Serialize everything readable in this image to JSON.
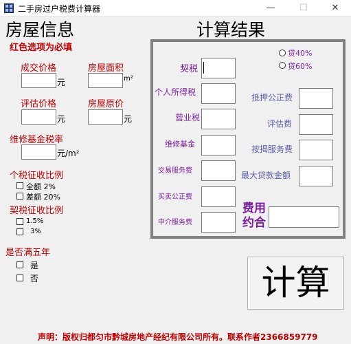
{
  "window": {
    "title": "二手房过户税费计算器",
    "minimize_glyph": "—",
    "maximize_glyph": "☐",
    "close_glyph": "✕"
  },
  "left": {
    "heading": "房屋信息",
    "required_note": "红色选项为必填",
    "deal_price_label": "成交价格",
    "deal_price_unit": "元",
    "area_label": "房屋面积",
    "area_unit": "m²",
    "eval_price_label": "评估价格",
    "eval_price_unit": "元",
    "orig_price_label": "房屋原价",
    "orig_price_unit": "元",
    "maint_rate_label": "维修基金税率",
    "maint_rate_unit": "元/m²",
    "income_tax_ratio_label": "个税征收比例",
    "income_full": "全额  2%",
    "income_diff": "差额 20%",
    "deed_tax_ratio_label": "契税征收比例",
    "deed_15": "1.5%",
    "deed_3": "3%",
    "five_years_label": "是否满五年",
    "yes": "是",
    "no": "否"
  },
  "right": {
    "heading": "计算结果",
    "loan40": "贷40%",
    "loan60": "贷60%",
    "deed_tax": "契税",
    "income_tax": "个人所得税",
    "business_tax": "营业税",
    "maint_fund": "维修基金",
    "trade_fee": "交易服务费",
    "sale_notary": "买卖公正费",
    "agency_fee": "中介服务费",
    "mortgage_notary": "抵押公正费",
    "eval_fee": "评估费",
    "mortgage_service": "按揭服务费",
    "max_loan": "最大贷款金额",
    "fee_agreed": "费用\n约合"
  },
  "calc_button": "计算",
  "footer": "声明：版权归都匀市黔城房地产经纪有限公司所有。联系作者2366859779"
}
